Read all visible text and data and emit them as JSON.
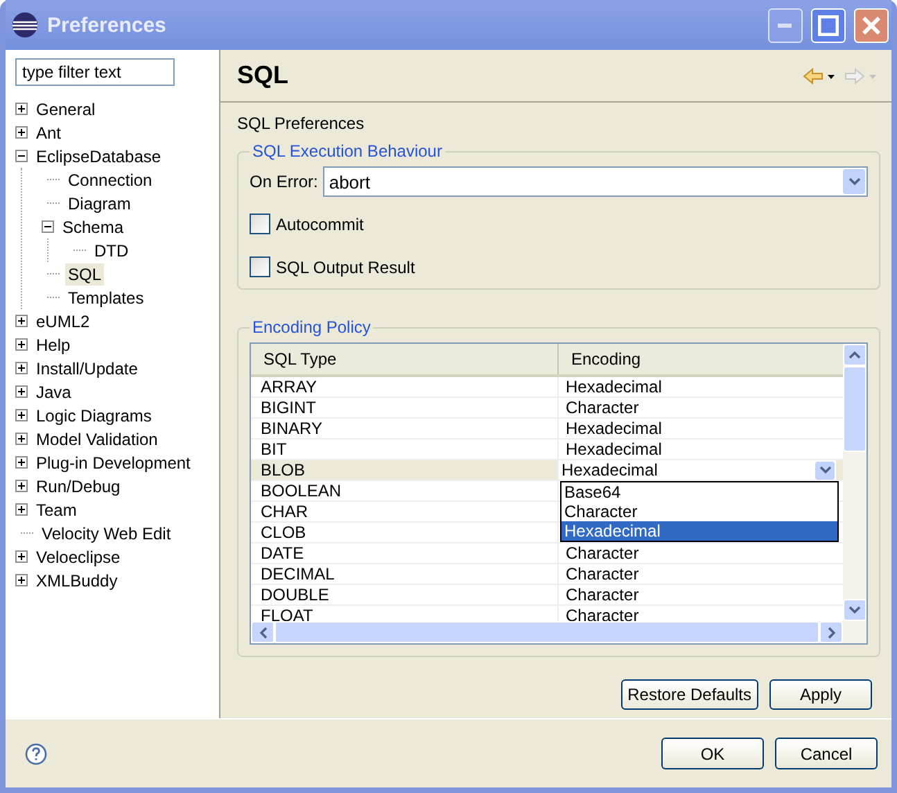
{
  "window": {
    "title": "Preferences"
  },
  "filter": {
    "placeholder": "type filter text"
  },
  "tree": [
    {
      "label": "General",
      "expanded": false,
      "selected": false
    },
    {
      "label": "Ant",
      "expanded": false,
      "selected": false
    },
    {
      "label": "EclipseDatabase",
      "expanded": true,
      "selected": false,
      "children": [
        {
          "label": "Connection",
          "selected": false
        },
        {
          "label": "Diagram",
          "selected": false
        },
        {
          "label": "Schema",
          "expanded": true,
          "selected": false,
          "children": [
            {
              "label": "DTD",
              "selected": false
            }
          ]
        },
        {
          "label": "SQL",
          "selected": true
        },
        {
          "label": "Templates",
          "selected": false
        }
      ]
    },
    {
      "label": "eUML2",
      "expanded": false,
      "selected": false
    },
    {
      "label": "Help",
      "expanded": false,
      "selected": false
    },
    {
      "label": "Install/Update",
      "expanded": false,
      "selected": false
    },
    {
      "label": "Java",
      "expanded": false,
      "selected": false
    },
    {
      "label": "Logic Diagrams",
      "expanded": false,
      "selected": false
    },
    {
      "label": "Model Validation",
      "expanded": false,
      "selected": false
    },
    {
      "label": "Plug-in Development",
      "expanded": false,
      "selected": false
    },
    {
      "label": "Run/Debug",
      "expanded": false,
      "selected": false
    },
    {
      "label": "Team",
      "expanded": false,
      "selected": false
    },
    {
      "label": "Velocity Web Edit",
      "selected": false
    },
    {
      "label": "Veloeclipse",
      "expanded": false,
      "selected": false
    },
    {
      "label": "XMLBuddy",
      "expanded": false,
      "selected": false
    }
  ],
  "page": {
    "title": "SQL",
    "description": "SQL Preferences"
  },
  "execution": {
    "title": "SQL Execution Behaviour",
    "on_error_label": "On Error:",
    "on_error_value": "abort",
    "checkboxes": [
      {
        "label": "Autocommit",
        "checked": false
      },
      {
        "label": "SQL Output Result",
        "checked": false
      }
    ]
  },
  "encoding": {
    "title": "Encoding Policy",
    "columns": [
      "SQL Type",
      "Encoding"
    ],
    "rows": [
      {
        "sql_type": "ARRAY",
        "encoding": "Hexadecimal",
        "selected": false
      },
      {
        "sql_type": "BIGINT",
        "encoding": "Character",
        "selected": false
      },
      {
        "sql_type": "BINARY",
        "encoding": "Hexadecimal",
        "selected": false
      },
      {
        "sql_type": "BIT",
        "encoding": "Hexadecimal",
        "selected": false
      },
      {
        "sql_type": "BLOB",
        "encoding": "Hexadecimal",
        "selected": true
      },
      {
        "sql_type": "BOOLEAN",
        "selected": false
      },
      {
        "sql_type": "CHAR",
        "selected": false
      },
      {
        "sql_type": "CLOB",
        "selected": false
      },
      {
        "sql_type": "DATE",
        "encoding": "Character",
        "selected": false
      },
      {
        "sql_type": "DECIMAL",
        "encoding": "Character",
        "selected": false
      },
      {
        "sql_type": "DOUBLE",
        "encoding": "Character",
        "selected": false
      },
      {
        "sql_type": "FLOAT",
        "encoding": "Character",
        "selected": false
      }
    ],
    "dropdown_options": [
      {
        "label": "Base64",
        "selected": false
      },
      {
        "label": "Character",
        "selected": false
      },
      {
        "label": "Hexadecimal",
        "selected": true
      }
    ]
  },
  "page_buttons": [
    "Restore Defaults",
    "Apply"
  ],
  "dialog_buttons": [
    "OK",
    "Cancel"
  ]
}
